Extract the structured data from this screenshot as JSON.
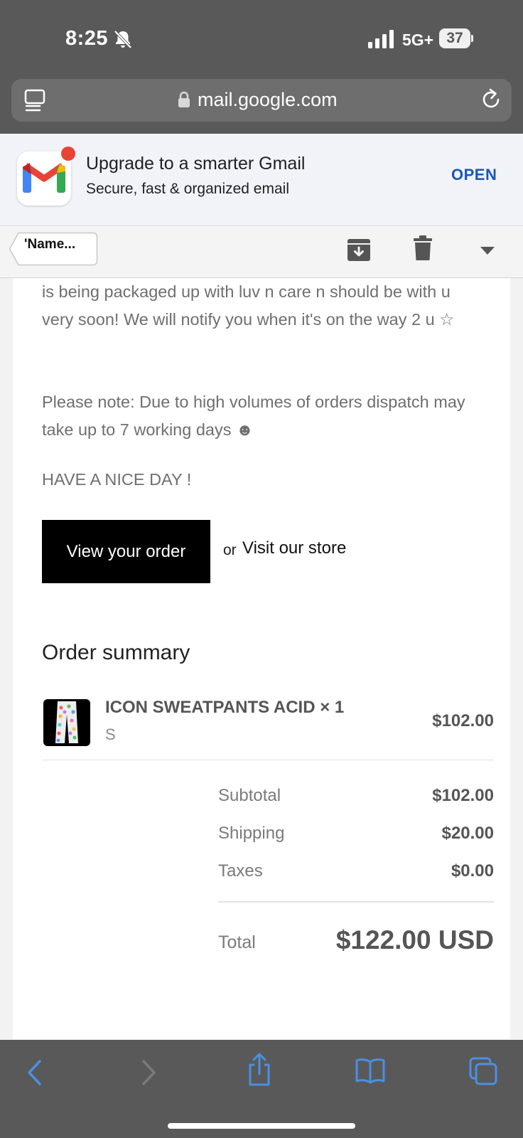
{
  "status_bar": {
    "time": "8:25",
    "network": "5G+",
    "battery": "37"
  },
  "browser": {
    "url": "mail.google.com"
  },
  "promo": {
    "title": "Upgrade to a smarter Gmail",
    "subtitle": "Secure, fast & organized email",
    "open_label": "OPEN"
  },
  "toolbar": {
    "back_label": "'Name..."
  },
  "email": {
    "paragraph_packaged": "is being packaged up with luv n care n should be with u very soon! We will notify you when it's on the way 2 u ☆",
    "paragraph_note": "Please note: Due to high volumes of orders dispatch may take up to 7 working days ☻",
    "greeting": "HAVE A NICE DAY !",
    "view_order_label": "View your order",
    "or_text": "or",
    "visit_store_label": "Visit our store",
    "order_summary": {
      "title": "Order summary",
      "item": {
        "name": "ICON SWEATPANTS ACID × 1",
        "variant": "S",
        "price": "$102.00"
      },
      "subtotal_label": "Subtotal",
      "subtotal_value": "$102.00",
      "shipping_label": "Shipping",
      "shipping_value": "$20.00",
      "taxes_label": "Taxes",
      "taxes_value": "$0.00",
      "total_label": "Total",
      "total_value": "$122.00 USD"
    }
  },
  "colors": {
    "accent": "#1a57b8",
    "chrome": "#595959",
    "ios_blue": "#4a90e2"
  }
}
